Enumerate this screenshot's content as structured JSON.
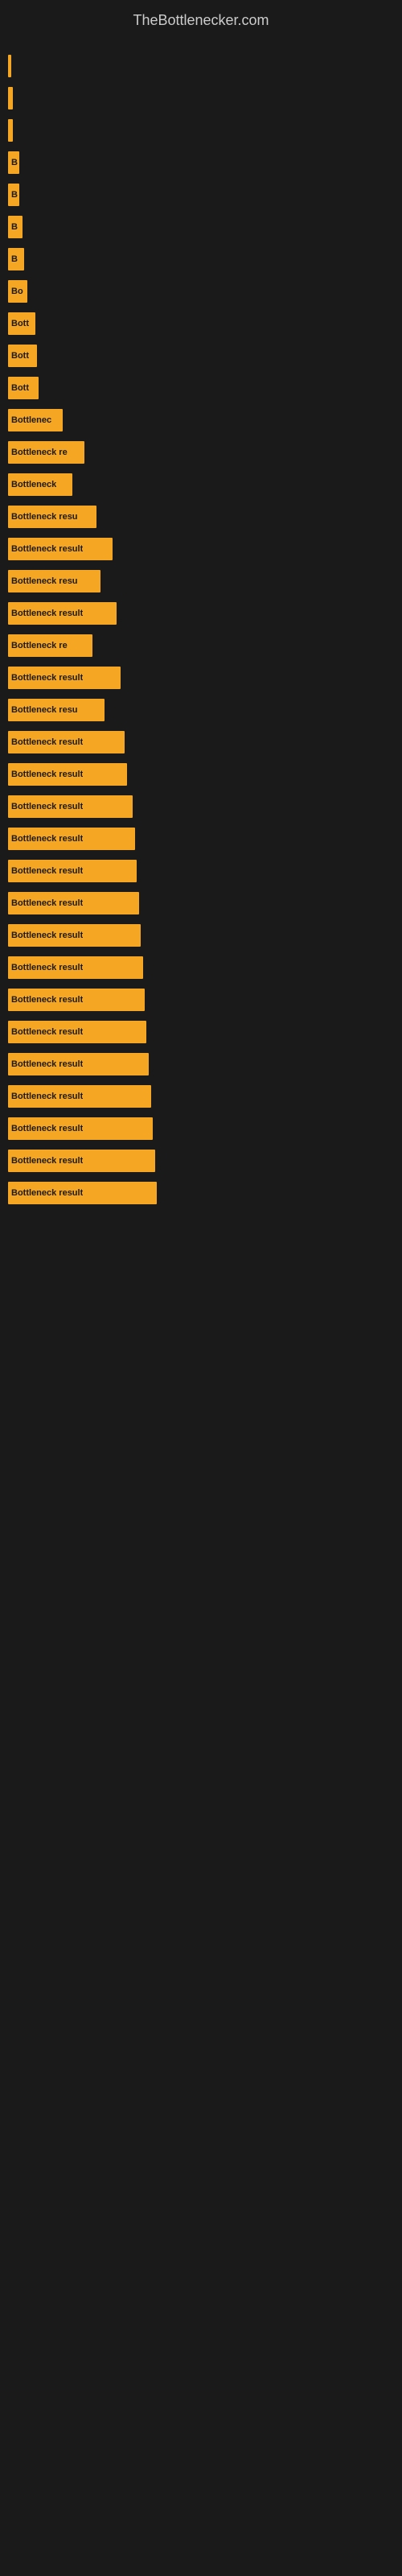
{
  "site": {
    "title": "TheBottlenecker.com"
  },
  "bars": [
    {
      "label": "",
      "width": 4
    },
    {
      "label": "",
      "width": 6
    },
    {
      "label": "",
      "width": 6
    },
    {
      "label": "B",
      "width": 14
    },
    {
      "label": "B",
      "width": 14
    },
    {
      "label": "B",
      "width": 18
    },
    {
      "label": "B",
      "width": 20
    },
    {
      "label": "Bo",
      "width": 24
    },
    {
      "label": "Bott",
      "width": 34
    },
    {
      "label": "Bott",
      "width": 36
    },
    {
      "label": "Bott",
      "width": 38
    },
    {
      "label": "Bottlenec",
      "width": 68
    },
    {
      "label": "Bottleneck re",
      "width": 95
    },
    {
      "label": "Bottleneck",
      "width": 80
    },
    {
      "label": "Bottleneck resu",
      "width": 110
    },
    {
      "label": "Bottleneck result",
      "width": 130
    },
    {
      "label": "Bottleneck resu",
      "width": 115
    },
    {
      "label": "Bottleneck result",
      "width": 135
    },
    {
      "label": "Bottleneck re",
      "width": 105
    },
    {
      "label": "Bottleneck result",
      "width": 140
    },
    {
      "label": "Bottleneck resu",
      "width": 120
    },
    {
      "label": "Bottleneck result",
      "width": 145
    },
    {
      "label": "Bottleneck result",
      "width": 148
    },
    {
      "label": "Bottleneck result",
      "width": 155
    },
    {
      "label": "Bottleneck result",
      "width": 158
    },
    {
      "label": "Bottleneck result",
      "width": 160
    },
    {
      "label": "Bottleneck result",
      "width": 163
    },
    {
      "label": "Bottleneck result",
      "width": 165
    },
    {
      "label": "Bottleneck result",
      "width": 168
    },
    {
      "label": "Bottleneck result",
      "width": 170
    },
    {
      "label": "Bottleneck result",
      "width": 172
    },
    {
      "label": "Bottleneck result",
      "width": 175
    },
    {
      "label": "Bottleneck result",
      "width": 178
    },
    {
      "label": "Bottleneck result",
      "width": 180
    },
    {
      "label": "Bottleneck result",
      "width": 183
    },
    {
      "label": "Bottleneck result",
      "width": 185
    }
  ]
}
